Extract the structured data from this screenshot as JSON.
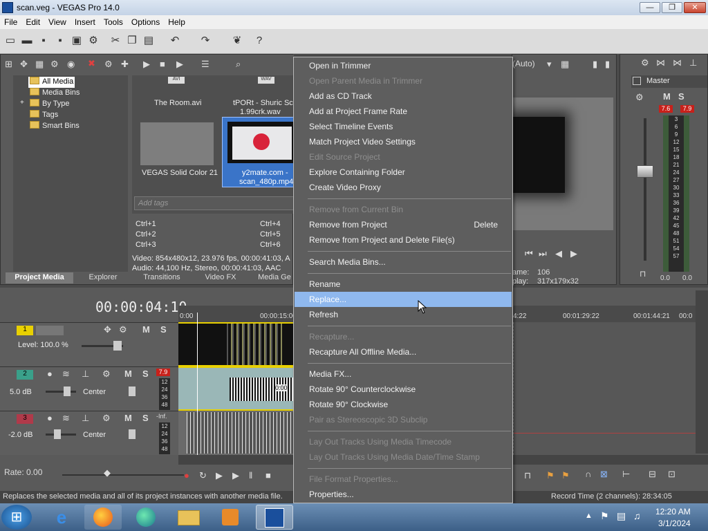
{
  "window": {
    "title": "scan.veg - VEGAS Pro 14.0",
    "min_label": "—",
    "max_label": "❐",
    "close_label": "✕"
  },
  "menubar": [
    "File",
    "Edit",
    "View",
    "Insert",
    "Tools",
    "Options",
    "Help"
  ],
  "media_tree": [
    "All Media",
    "Media Bins",
    "By Type",
    "Tags",
    "Smart Bins"
  ],
  "tree_expand": "+",
  "media_files": {
    "avi_badge": "AVI",
    "wav_badge": "WAV",
    "room": "The Room.avi",
    "wav_name_1": "tPORt - Shuric Sca",
    "wav_name_2": "1.99crk.wav",
    "solid": "VEGAS Solid Color 21",
    "mp4_name_1": "y2mate.com -",
    "mp4_name_2": "scan_480p.mp4"
  },
  "tags": {
    "placeholder": "Add tags",
    "shortcuts": [
      "Ctrl+1",
      "Ctrl+2",
      "Ctrl+3",
      "Ctrl+4",
      "Ctrl+5",
      "Ctrl+6"
    ]
  },
  "media_info": {
    "video": "Video: 854x480x12, 23.976 fps, 00:00:41:03, A",
    "audio": "Audio: 44,100 Hz, Stereo, 00:00:41:03, AAC"
  },
  "tabs": [
    "Project Media",
    "Explorer",
    "Transitions",
    "Video FX",
    "Media Ge"
  ],
  "preview": {
    "mode": "(Auto)",
    "frame_label": "ame:",
    "frame_value": "106",
    "display_label": "play:",
    "display_value": "317x179x32"
  },
  "master": {
    "label": "Master",
    "m": "M",
    "s": "S",
    "peak_left": "7.6",
    "peak_right": "7.9",
    "scale": [
      "3",
      "6",
      "9",
      "12",
      "15",
      "18",
      "21",
      "24",
      "27",
      "30",
      "33",
      "36",
      "39",
      "42",
      "45",
      "48",
      "51",
      "54",
      "57"
    ],
    "db_left": "0.0",
    "db_right": "0.0"
  },
  "timeline": {
    "time": "00:00:04:10",
    "ruler_left": [
      "0:00",
      "00:00:15:00"
    ],
    "ruler_right": [
      "4:22",
      "00:01:29:22",
      "00:01:44:21",
      "00:0"
    ],
    "tracks": [
      {
        "num": "1",
        "level": "Level: 100.0 %",
        "m": "M",
        "s": "S"
      },
      {
        "num": "2",
        "db": "5.0 dB",
        "pan": "Center",
        "m": "M",
        "s": "S",
        "peak": "7.9",
        "scale": [
          "12",
          "24",
          "36",
          "48"
        ],
        "clip_time": "0:00"
      },
      {
        "num": "3",
        "db": "-2.0 dB",
        "pan": "Center",
        "m": "M",
        "s": "S",
        "peak": "-Inf.",
        "scale": [
          "12",
          "24",
          "36",
          "48"
        ]
      }
    ],
    "rate": "Rate: 0.00"
  },
  "context_menu": {
    "items": [
      {
        "label": "Open in Trimmer",
        "enabled": true
      },
      {
        "label": "Open Parent Media in Trimmer",
        "enabled": false
      },
      {
        "label": "Add as CD Track",
        "enabled": true
      },
      {
        "label": "Add at Project Frame Rate",
        "enabled": true
      },
      {
        "label": "Select Timeline Events",
        "enabled": true
      },
      {
        "label": "Match Project Video Settings",
        "enabled": true
      },
      {
        "label": "Edit Source Project",
        "enabled": false
      },
      {
        "label": "Explore Containing Folder",
        "enabled": true
      },
      {
        "label": "Create Video Proxy",
        "enabled": true
      },
      {
        "label": "Remove from Current Bin",
        "enabled": false
      },
      {
        "label": "Remove from Project",
        "enabled": true,
        "shortcut": "Delete"
      },
      {
        "label": "Remove from Project and Delete File(s)",
        "enabled": true
      },
      {
        "label": "Search Media Bins...",
        "enabled": true
      },
      {
        "label": "Rename",
        "enabled": true
      },
      {
        "label": "Replace...",
        "enabled": true,
        "highlighted": true
      },
      {
        "label": "Refresh",
        "enabled": true
      },
      {
        "label": "Recapture...",
        "enabled": false
      },
      {
        "label": "Recapture All Offline Media...",
        "enabled": true
      },
      {
        "label": "Media FX...",
        "enabled": true
      },
      {
        "label": "Rotate 90° Counterclockwise",
        "enabled": true
      },
      {
        "label": "Rotate 90° Clockwise",
        "enabled": true
      },
      {
        "label": "Pair as Stereoscopic 3D Subclip",
        "enabled": false
      },
      {
        "label": "Lay Out Tracks Using Media Timecode",
        "enabled": false
      },
      {
        "label": "Lay Out Tracks Using Media Date/Time Stamp",
        "enabled": false
      },
      {
        "label": "File Format Properties...",
        "enabled": false
      },
      {
        "label": "Properties...",
        "enabled": true
      }
    ]
  },
  "status_bar": {
    "hint": "Replaces the selected media and all of its project instances with another media file.",
    "record_time": "Record Time (2 channels): 28:34:05"
  },
  "taskbar": {
    "time": "12:20 AM",
    "date": "3/1/2024",
    "tray_arrow": "▲",
    "tray_flag": "⚑",
    "tray_net": "▤",
    "tray_vol": "♫",
    "start_icon": "⊞",
    "ie_icon": "e"
  },
  "colors": {
    "menu_highlight": "#8fb8ee",
    "meter_peak": "#c8201a",
    "track_yellow": "#e8d000"
  }
}
